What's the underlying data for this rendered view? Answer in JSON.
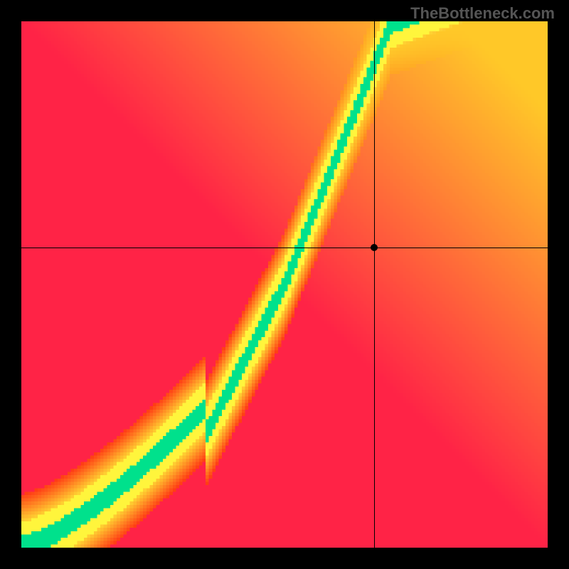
{
  "watermark": "TheBottleneck.com",
  "chart_data": {
    "type": "heatmap",
    "title": "",
    "xlabel": "",
    "ylabel": "",
    "xlim": [
      0,
      1
    ],
    "ylim": [
      0,
      1
    ],
    "crosshair": {
      "x": 0.67,
      "y": 0.57
    },
    "marker": {
      "x": 0.67,
      "y": 0.57
    },
    "colormap_note": "green along an S-shaped optimal diagonal, yellow halo, red far from curve; corners tinted yellow-orange",
    "optimal_curve_samples": [
      {
        "x": 0.0,
        "y": 0.0
      },
      {
        "x": 0.1,
        "y": 0.05
      },
      {
        "x": 0.2,
        "y": 0.12
      },
      {
        "x": 0.3,
        "y": 0.22
      },
      {
        "x": 0.4,
        "y": 0.35
      },
      {
        "x": 0.5,
        "y": 0.52
      },
      {
        "x": 0.55,
        "y": 0.63
      },
      {
        "x": 0.6,
        "y": 0.75
      },
      {
        "x": 0.65,
        "y": 0.87
      },
      {
        "x": 0.7,
        "y": 0.98
      },
      {
        "x": 0.75,
        "y": 1.0
      },
      {
        "x": 0.85,
        "y": 1.0
      },
      {
        "x": 1.0,
        "y": 1.0
      }
    ],
    "grid_resolution": 160
  }
}
